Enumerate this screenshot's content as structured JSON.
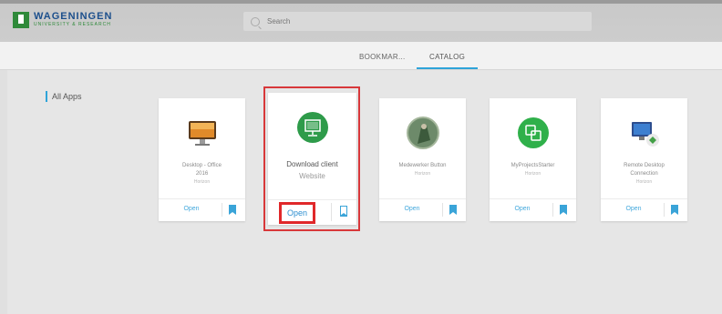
{
  "brand": {
    "name": "WAGENINGEN",
    "sub": "UNIVERSITY & RESEARCH"
  },
  "search": {
    "placeholder": "Search"
  },
  "tabs": [
    {
      "label": "BOOKMAR..."
    },
    {
      "label": "CATALOG"
    }
  ],
  "sidebar": {
    "all_apps": "All Apps"
  },
  "apps": [
    {
      "name_line1": "Desktop - Office",
      "name_line2": "2016",
      "type": "Horizon",
      "open": "Open",
      "icon": "monitor-icon"
    },
    {
      "name_line1": "Download client",
      "name_line2": "",
      "type": "Website",
      "open": "Open",
      "icon": "presentation-icon"
    },
    {
      "name_line1": "Medewerker Button",
      "name_line2": "",
      "type": "Horizon",
      "open": "Open",
      "icon": "avatar-icon"
    },
    {
      "name_line1": "MyProjectsStarter",
      "name_line2": "",
      "type": "Horizon",
      "open": "Open",
      "icon": "projects-icon"
    },
    {
      "name_line1": "Remote Desktop",
      "name_line2": "Connection",
      "type": "Horizon",
      "open": "Open",
      "icon": "remote-desktop-icon"
    }
  ],
  "colors": {
    "accent": "#2fa4d9",
    "highlight": "#e0282a",
    "brand_green": "#2f8a3a",
    "brand_blue": "#1c4f8c"
  }
}
